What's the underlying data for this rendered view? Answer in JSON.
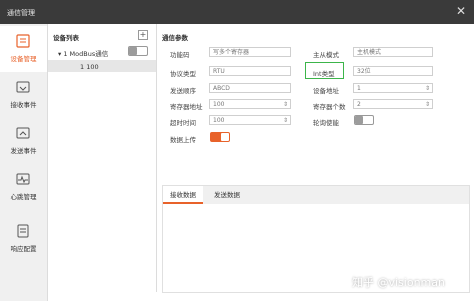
{
  "window": {
    "title": "通信管理",
    "close_glyph": "✕"
  },
  "sidebar": {
    "items": [
      {
        "label": "设备管理",
        "icon": "device-manage-icon",
        "active": true
      },
      {
        "label": "接收事件",
        "icon": "receive-event-icon",
        "active": false
      },
      {
        "label": "发送事件",
        "icon": "send-event-icon",
        "active": false
      },
      {
        "label": "心跳管理",
        "icon": "heartbeat-icon",
        "active": false
      },
      {
        "label": "响应配置",
        "icon": "response-config-icon",
        "active": false
      }
    ]
  },
  "device_panel": {
    "title": "设备列表",
    "add_glyph": "+",
    "tree": [
      {
        "label": "▾ 1 ModBus通信",
        "toggle": "off"
      },
      {
        "label": "1 100"
      }
    ]
  },
  "params": {
    "title": "通信参数",
    "left": [
      {
        "label": "功能码",
        "value": "写多个寄存器",
        "kind": "text"
      },
      {
        "label": "协议类型",
        "value": "RTU",
        "kind": "text"
      },
      {
        "label": "发送顺序",
        "value": "ABCD",
        "kind": "text"
      },
      {
        "label": "寄存器地址",
        "value": "100",
        "kind": "spin"
      },
      {
        "label": "超时时间",
        "value": "100",
        "kind": "spin"
      },
      {
        "label": "数据上传",
        "kind": "toggle",
        "state": "on"
      }
    ],
    "right": [
      {
        "label": "主从模式",
        "value": "主机模式",
        "kind": "text"
      },
      {
        "label": "Int类型",
        "value": "32位",
        "kind": "text",
        "highlighted": true
      },
      {
        "label": "设备地址",
        "value": "1",
        "kind": "spin"
      },
      {
        "label": "寄存器个数",
        "value": "2",
        "kind": "spin"
      },
      {
        "label": "轮询使能",
        "kind": "toggle",
        "state": "off"
      }
    ]
  },
  "data_panel": {
    "tabs": [
      {
        "label": "接收数据",
        "active": true
      },
      {
        "label": "发送数据",
        "active": false
      }
    ]
  },
  "watermark": "知乎 @visionman",
  "colors": {
    "accent": "#e8622a",
    "highlight": "#3cb54a",
    "titlebar": "#3a3a3a"
  }
}
